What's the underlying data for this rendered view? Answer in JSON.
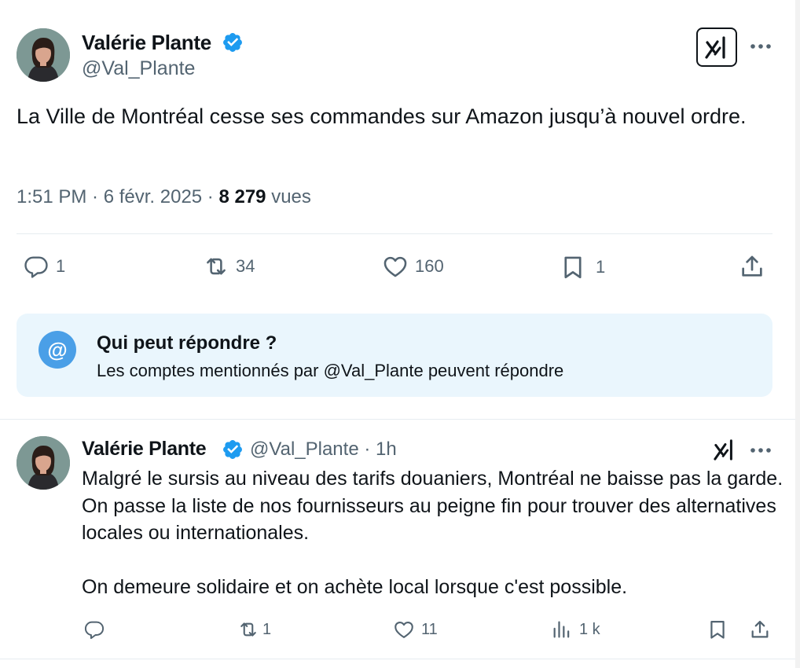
{
  "main_post": {
    "author_name": "Valérie Plante",
    "author_handle": "@Val_Plante",
    "text": "La Ville de Montréal cesse ses commandes sur Amazon jusqu’à nouvel ordre.",
    "timestamp": "1:51 PM · 6 févr. 2025 · ",
    "views_count": "8 279",
    "views_label": " vues",
    "actions": {
      "replies": "1",
      "reposts": "34",
      "likes": "160",
      "bookmarks": "1"
    },
    "icons": [
      "verified-badge-icon",
      "grok-icon",
      "more-icon",
      "reply-icon",
      "repost-icon",
      "like-icon",
      "bookmark-icon",
      "share-icon"
    ]
  },
  "reply_restriction": {
    "title": "Qui peut répondre ?",
    "description": "Les comptes mentionnés par @Val_Plante peuvent répondre",
    "icon_text": "@"
  },
  "reply_post": {
    "author_name": "Valérie Plante",
    "author_handle": "@Val_Plante · 1h",
    "paragraph_1": "Malgré le sursis au niveau des tarifs douaniers, Montréal ne baisse pas la garde. On passe la liste de nos fournisseurs au peigne fin pour trouver des alternatives locales ou internationales.",
    "paragraph_2": "On demeure solidaire et on achète local lorsque c'est possible.",
    "actions": {
      "replies": "",
      "reposts": "1",
      "likes": "11",
      "views": "1 k"
    }
  },
  "colors": {
    "text_primary": "#0f1419",
    "text_secondary": "#536471",
    "verified_blue": "#1d9bf0",
    "reply_box_bg": "#eaf6fd",
    "at_circle": "#4a9fe7"
  }
}
